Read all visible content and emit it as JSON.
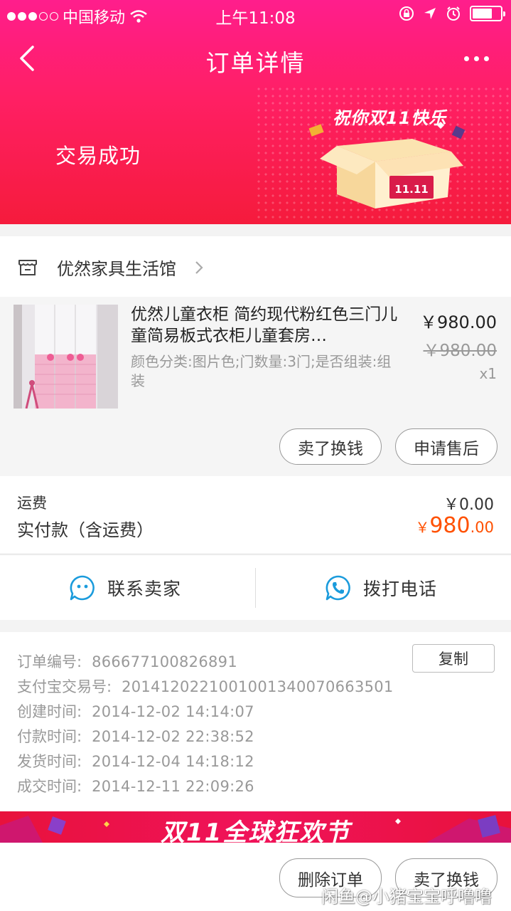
{
  "status_bar": {
    "carrier": "中国移动",
    "time": "上午11:08"
  },
  "nav": {
    "title": "订单详情"
  },
  "header": {
    "trade_status": "交易成功",
    "promo_title": "祝你双11快乐",
    "promo_badge": "11.11"
  },
  "shop": {
    "name": "优然家具生活馆"
  },
  "product": {
    "title": "优然儿童衣柜 简约现代粉红色三门儿童简易板式衣柜儿童套房…",
    "spec": "颜色分类:图片色;门数量:3门;是否组装:组装",
    "price": "￥980.00",
    "original_price": "￥980.00",
    "quantity": "x1",
    "actions": [
      "卖了换钱",
      "申请售后"
    ]
  },
  "fees": {
    "shipping_label": "运费",
    "shipping_value": "￥0.00",
    "paid_label": "实付款（含运费）",
    "paid_currency": "￥",
    "paid_integer": "980",
    "paid_decimal": ".00"
  },
  "contact": {
    "seller_label": "联系卖家",
    "phone_label": "拨打电话"
  },
  "order_info": {
    "copy_label": "复制",
    "rows": [
      {
        "label": "订单编号:",
        "value": "866677100826891"
      },
      {
        "label": "支付宝交易号:",
        "value": "2014120221001001340070663501"
      },
      {
        "label": "创建时间:",
        "value": "2014-12-02 14:14:07"
      },
      {
        "label": "付款时间:",
        "value": "2014-12-02 22:38:52"
      },
      {
        "label": "发货时间:",
        "value": "2014-12-04 14:18:12"
      },
      {
        "label": "成交时间:",
        "value": "2014-12-11 22:09:26"
      }
    ]
  },
  "banner": {
    "text": "双11全球狂欢节"
  },
  "footer": {
    "delete_label": "删除订单",
    "sell_label": "卖了换钱",
    "watermark": "闲鱼@小猪宝宝呼噜噜"
  },
  "colors": {
    "header_pink": "#ff1e8c",
    "header_red": "#f51b3c",
    "price_orange": "#ff5000",
    "contact_blue": "#1a9bdc"
  }
}
